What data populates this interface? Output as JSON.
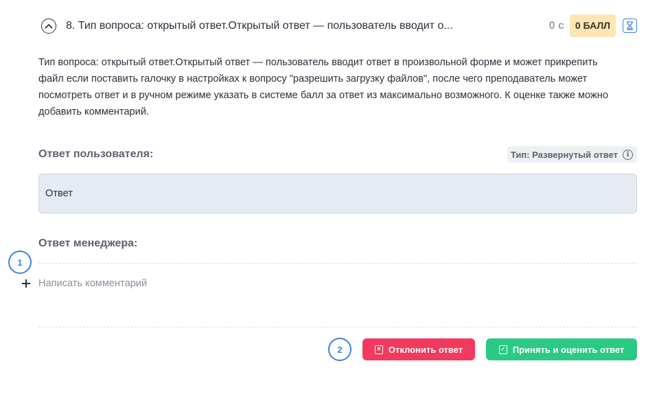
{
  "question": {
    "title": "8. Тип вопроса: открытый ответ.Открытый ответ — пользователь вводит о...",
    "timer": "0 с",
    "score_badge": "0 БАЛЛ",
    "description": "Тип вопроса: открытый ответ.Открытый ответ — пользователь вводит ответ в произвольной форме и может прикрепить файл если поставить галочку в настройках к вопросу \"разрешить загрузку файлов\", после чего преподаватель может посмотреть ответ и в ручном режиме указать в системе балл за ответ из максимально возможного. К оценке также можно добавить комментарий."
  },
  "user_answer": {
    "label": "Ответ пользователя:",
    "type_tag": "Тип: Развернутый ответ",
    "info_icon": "i",
    "value": "Ответ"
  },
  "manager_answer": {
    "label": "Ответ менеджера:",
    "add_comment_label": "Написать комментарий"
  },
  "markers": {
    "step_1": "1",
    "step_2": "2"
  },
  "actions": {
    "reject_label": "Отклонить ответ",
    "accept_label": "Принять и оценить ответ"
  },
  "icons": {
    "collapse": "chevron-up-icon",
    "hourglass": "hourglass-icon",
    "info": "info-icon",
    "plus": "plus-icon",
    "reject": "reject-doc-icon",
    "accept": "check-square-icon"
  },
  "colors": {
    "accent_blue": "#3b82e0",
    "reject_red": "#f23a5e",
    "accept_green": "#2cc985",
    "score_badge_bg": "#fde5b4",
    "answer_box_bg": "#e6eaf2"
  }
}
